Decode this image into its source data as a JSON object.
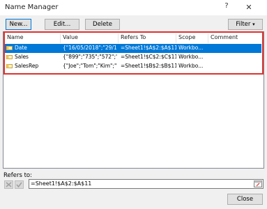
{
  "window": {
    "title": "Name Manager",
    "help_glyph": "?",
    "close_glyph": "✕"
  },
  "toolbar": {
    "new_label": "New...",
    "edit_label": "Edit...",
    "delete_label": "Delete",
    "filter_label": "Filter"
  },
  "columns": [
    "Name",
    "Value",
    "Refers To",
    "Scope",
    "Comment"
  ],
  "rows": [
    {
      "name": "Date",
      "value": "{\"16/05/2018\";\"29/1...",
      "refers_to": "=Sheet1!$A$2:$A$11",
      "scope": "Workbo...",
      "comment": "",
      "selected": true,
      "icon": "name-range-icon"
    },
    {
      "name": "Sales",
      "value": "{\"899\";\"735\";\"572\";\"...",
      "refers_to": "=Sheet1!$C$2:$C$11",
      "scope": "Workbo...",
      "comment": "",
      "selected": false,
      "icon": "name-range-icon"
    },
    {
      "name": "SalesRep",
      "value": "{\"Joe\";\"Tom\";\"Kim\";\"...",
      "refers_to": "=Sheet1!$B$2:$B$11",
      "scope": "Workbo...",
      "comment": "",
      "selected": false,
      "icon": "name-range-icon"
    }
  ],
  "refers": {
    "label": "Refers to:",
    "value": "=Sheet1!$A$2:$A$11"
  },
  "footer": {
    "close_label": "Close"
  },
  "colors": {
    "selection": "#0078d7",
    "highlight_border": "#e0322f"
  }
}
